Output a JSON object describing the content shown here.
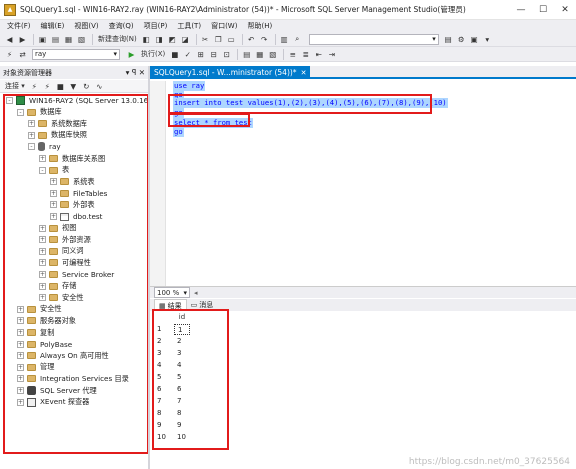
{
  "window": {
    "title": "SQLQuery1.sql - WIN16-RAY2.ray (WIN16-RAY2\\Administrator (54))* - Microsoft SQL Server Management Studio(管理员)",
    "min": "—",
    "max": "☐",
    "close": "✕"
  },
  "menu": [
    "文件(F)",
    "编辑(E)",
    "视图(V)",
    "查询(Q)",
    "项目(P)",
    "工具(T)",
    "窗口(W)",
    "帮助(H)"
  ],
  "toolbar": {
    "new_query": "新建查询(N)",
    "execute": "执行(X)",
    "database_combo": "ray"
  },
  "object_explorer": {
    "title": "对象资源管理器",
    "header_controls": "▾ ꟼ ✕",
    "connect": "连接 ▾",
    "tree": [
      {
        "label": "WIN16-RAY2 (SQL Server 13.0.1601",
        "level": 0,
        "exp": "-",
        "icon": "server"
      },
      {
        "label": "数据库",
        "level": 1,
        "exp": "-",
        "icon": "folder"
      },
      {
        "label": "系统数据库",
        "level": 2,
        "exp": "+",
        "icon": "folder"
      },
      {
        "label": "数据库快照",
        "level": 2,
        "exp": "+",
        "icon": "folder"
      },
      {
        "label": "ray",
        "level": 2,
        "exp": "-",
        "icon": "db"
      },
      {
        "label": "数据库关系图",
        "level": 3,
        "exp": "+",
        "icon": "folder"
      },
      {
        "label": "表",
        "level": 3,
        "exp": "-",
        "icon": "folder"
      },
      {
        "label": "系统表",
        "level": 4,
        "exp": "+",
        "icon": "folder"
      },
      {
        "label": "FileTables",
        "level": 4,
        "exp": "+",
        "icon": "folder"
      },
      {
        "label": "外部表",
        "level": 4,
        "exp": "+",
        "icon": "folder"
      },
      {
        "label": "dbo.test",
        "level": 4,
        "exp": "+",
        "icon": "table"
      },
      {
        "label": "视图",
        "level": 3,
        "exp": "+",
        "icon": "folder"
      },
      {
        "label": "外部资源",
        "level": 3,
        "exp": "+",
        "icon": "folder"
      },
      {
        "label": "同义词",
        "level": 3,
        "exp": "+",
        "icon": "folder"
      },
      {
        "label": "可编程性",
        "level": 3,
        "exp": "+",
        "icon": "folder"
      },
      {
        "label": "Service Broker",
        "level": 3,
        "exp": "+",
        "icon": "folder"
      },
      {
        "label": "存储",
        "level": 3,
        "exp": "+",
        "icon": "folder"
      },
      {
        "label": "安全性",
        "level": 3,
        "exp": "+",
        "icon": "folder"
      },
      {
        "label": "安全性",
        "level": 1,
        "exp": "+",
        "icon": "folder"
      },
      {
        "label": "服务器对象",
        "level": 1,
        "exp": "+",
        "icon": "folder"
      },
      {
        "label": "复制",
        "level": 1,
        "exp": "+",
        "icon": "folder"
      },
      {
        "label": "PolyBase",
        "level": 1,
        "exp": "+",
        "icon": "folder"
      },
      {
        "label": "Always On 高可用性",
        "level": 1,
        "exp": "+",
        "icon": "folder"
      },
      {
        "label": "管理",
        "level": 1,
        "exp": "+",
        "icon": "folder"
      },
      {
        "label": "Integration Services 目录",
        "level": 1,
        "exp": "+",
        "icon": "folder"
      },
      {
        "label": "SQL Server 代理",
        "level": 1,
        "exp": "+",
        "icon": "agent"
      },
      {
        "label": "XEvent 探查器",
        "level": 1,
        "exp": "+",
        "icon": "xevent"
      }
    ]
  },
  "editor": {
    "tab_title": "SQLQuery1.sql - W...ministrator (54))*",
    "tab_close": "✕",
    "lines": [
      "use ray",
      "go",
      "insert into test values(1),(2),(3),(4),(5),(6),(7),(8),(9),(10)",
      "go",
      "select * from test",
      "go"
    ]
  },
  "zoom": "100 %",
  "results": {
    "tab_results": "结果",
    "tab_messages": "消息",
    "column": "id",
    "row_numbers": [
      "1",
      "2",
      "3",
      "4",
      "5",
      "6",
      "7",
      "8",
      "9",
      "10"
    ],
    "values": [
      "1",
      "2",
      "3",
      "4",
      "5",
      "6",
      "7",
      "8",
      "9",
      "10"
    ]
  },
  "watermark": "https://blog.csdn.net/m0_37625564",
  "colors": {
    "accent": "#007acc",
    "annotation_red": "#e21b1b",
    "selection": "#add6ff"
  }
}
